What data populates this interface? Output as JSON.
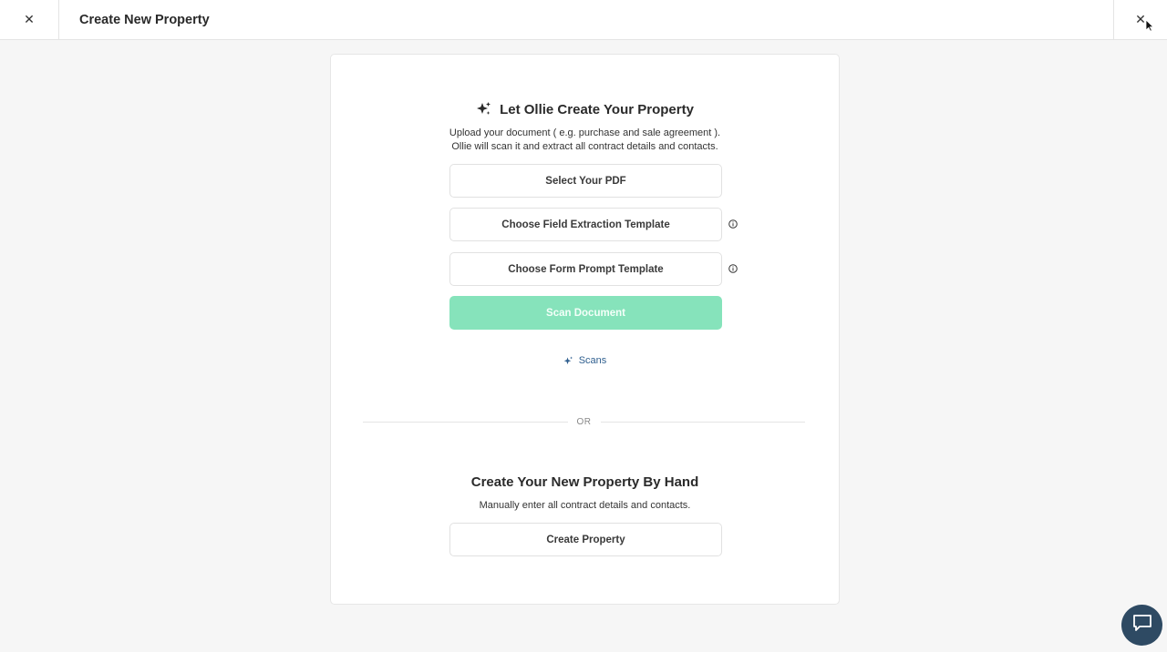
{
  "header": {
    "close_left_icon": "close-icon",
    "title": "Create New Property",
    "close_right_icon": "close-icon"
  },
  "ai_section": {
    "icon": "sparkle-icon",
    "title": "Let Ollie Create Your Property",
    "description_line1": "Upload your document ( e.g. purchase and sale agreement ).",
    "description_line2": "Ollie will scan it and extract all contract details and contacts.",
    "select_pdf_label": "Select Your PDF",
    "field_template_label": "Choose Field Extraction Template",
    "form_template_label": "Choose Form Prompt Template",
    "scan_label": "Scan Document",
    "scans_link_label": "Scans"
  },
  "divider_label": "OR",
  "manual_section": {
    "title": "Create Your New Property By Hand",
    "description": "Manually enter all contract details and contacts.",
    "create_label": "Create Property"
  },
  "colors": {
    "scan_button_bg": "#86e3bb",
    "chat_button_bg": "#2e4a63",
    "link_color": "#2f5f8f"
  },
  "chat": {
    "icon": "chat-bubble-icon"
  }
}
